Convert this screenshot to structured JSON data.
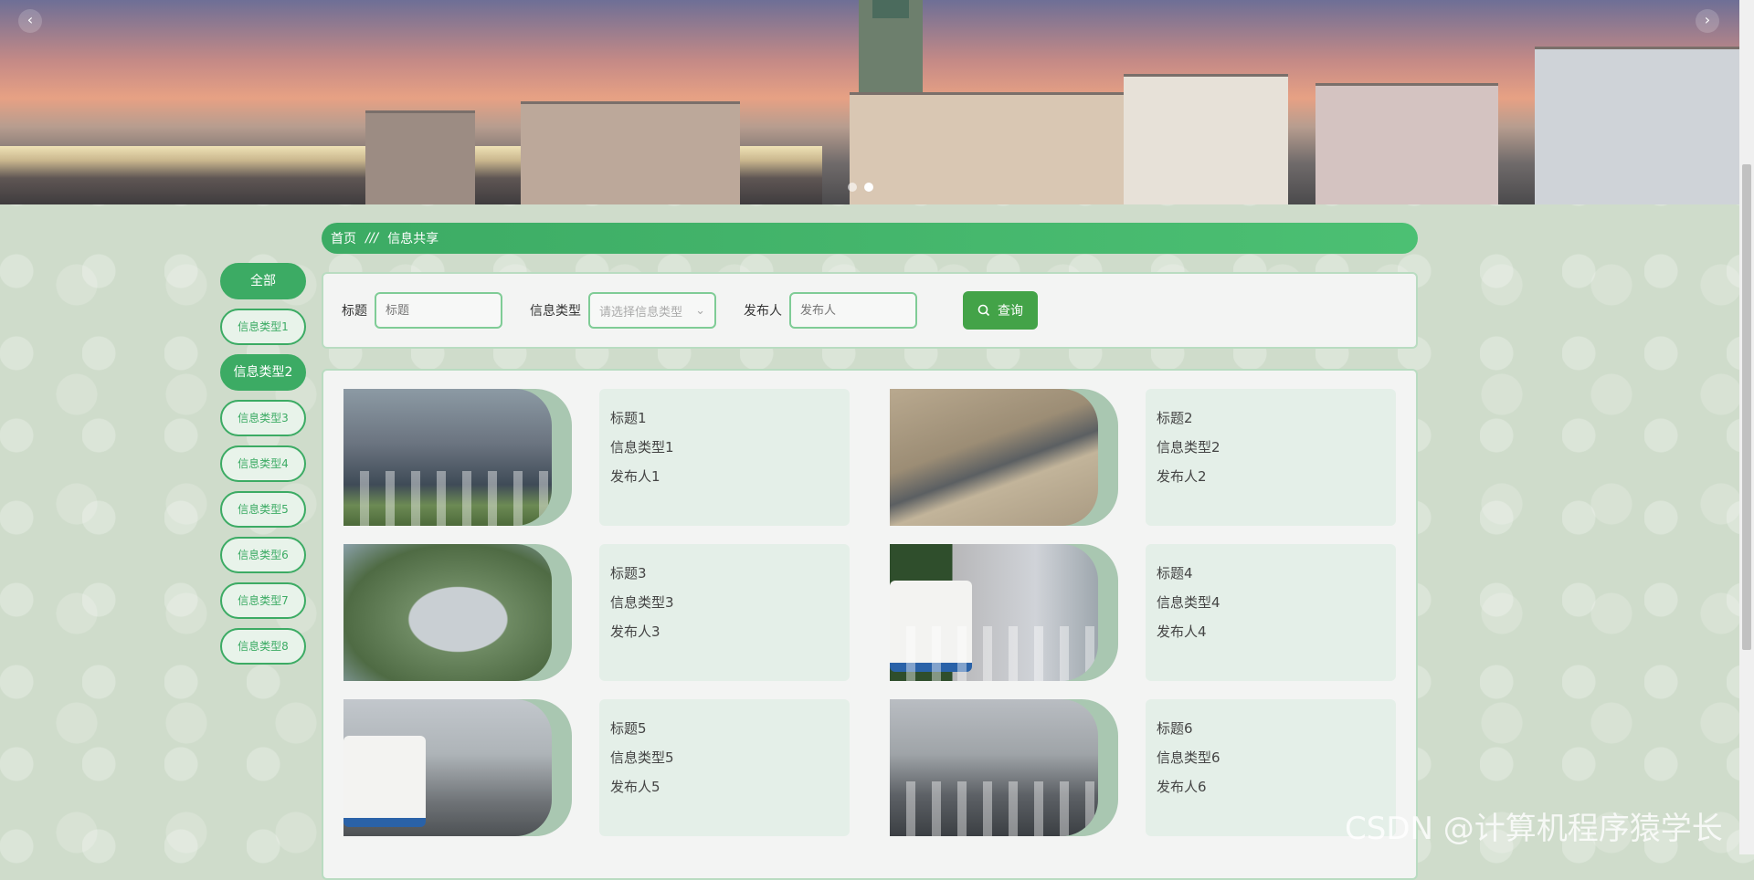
{
  "banner": {
    "prev_label": "‹",
    "next_label": "›",
    "dots_count": 2
  },
  "breadcrumb": {
    "home": "首页",
    "separator": "///",
    "current": "信息共享"
  },
  "sidebar": {
    "categories": [
      {
        "label": "全部"
      },
      {
        "label": "信息类型1"
      },
      {
        "label": "信息类型2"
      },
      {
        "label": "信息类型3"
      },
      {
        "label": "信息类型4"
      },
      {
        "label": "信息类型5"
      },
      {
        "label": "信息类型6"
      },
      {
        "label": "信息类型7"
      },
      {
        "label": "信息类型8"
      }
    ],
    "active_indices": [
      0,
      2
    ]
  },
  "search": {
    "title_label": "标题",
    "title_placeholder": "标题",
    "type_label": "信息类型",
    "type_placeholder": "请选择信息类型",
    "publisher_label": "发布人",
    "publisher_placeholder": "发布人",
    "query_button": "查询"
  },
  "items": [
    {
      "title": "标题1",
      "type": "信息类型1",
      "publisher": "发布人1"
    },
    {
      "title": "标题2",
      "type": "信息类型2",
      "publisher": "发布人2"
    },
    {
      "title": "标题3",
      "type": "信息类型3",
      "publisher": "发布人3"
    },
    {
      "title": "标题4",
      "type": "信息类型4",
      "publisher": "发布人4"
    },
    {
      "title": "标题5",
      "type": "信息类型5",
      "publisher": "发布人5"
    },
    {
      "title": "标题6",
      "type": "信息类型6",
      "publisher": "发布人6"
    }
  ],
  "watermark": "CSDN @计算机程序猿学长",
  "colors": {
    "accent": "#3cab64",
    "button": "#43a348",
    "panel_border": "#b9dcc1"
  }
}
